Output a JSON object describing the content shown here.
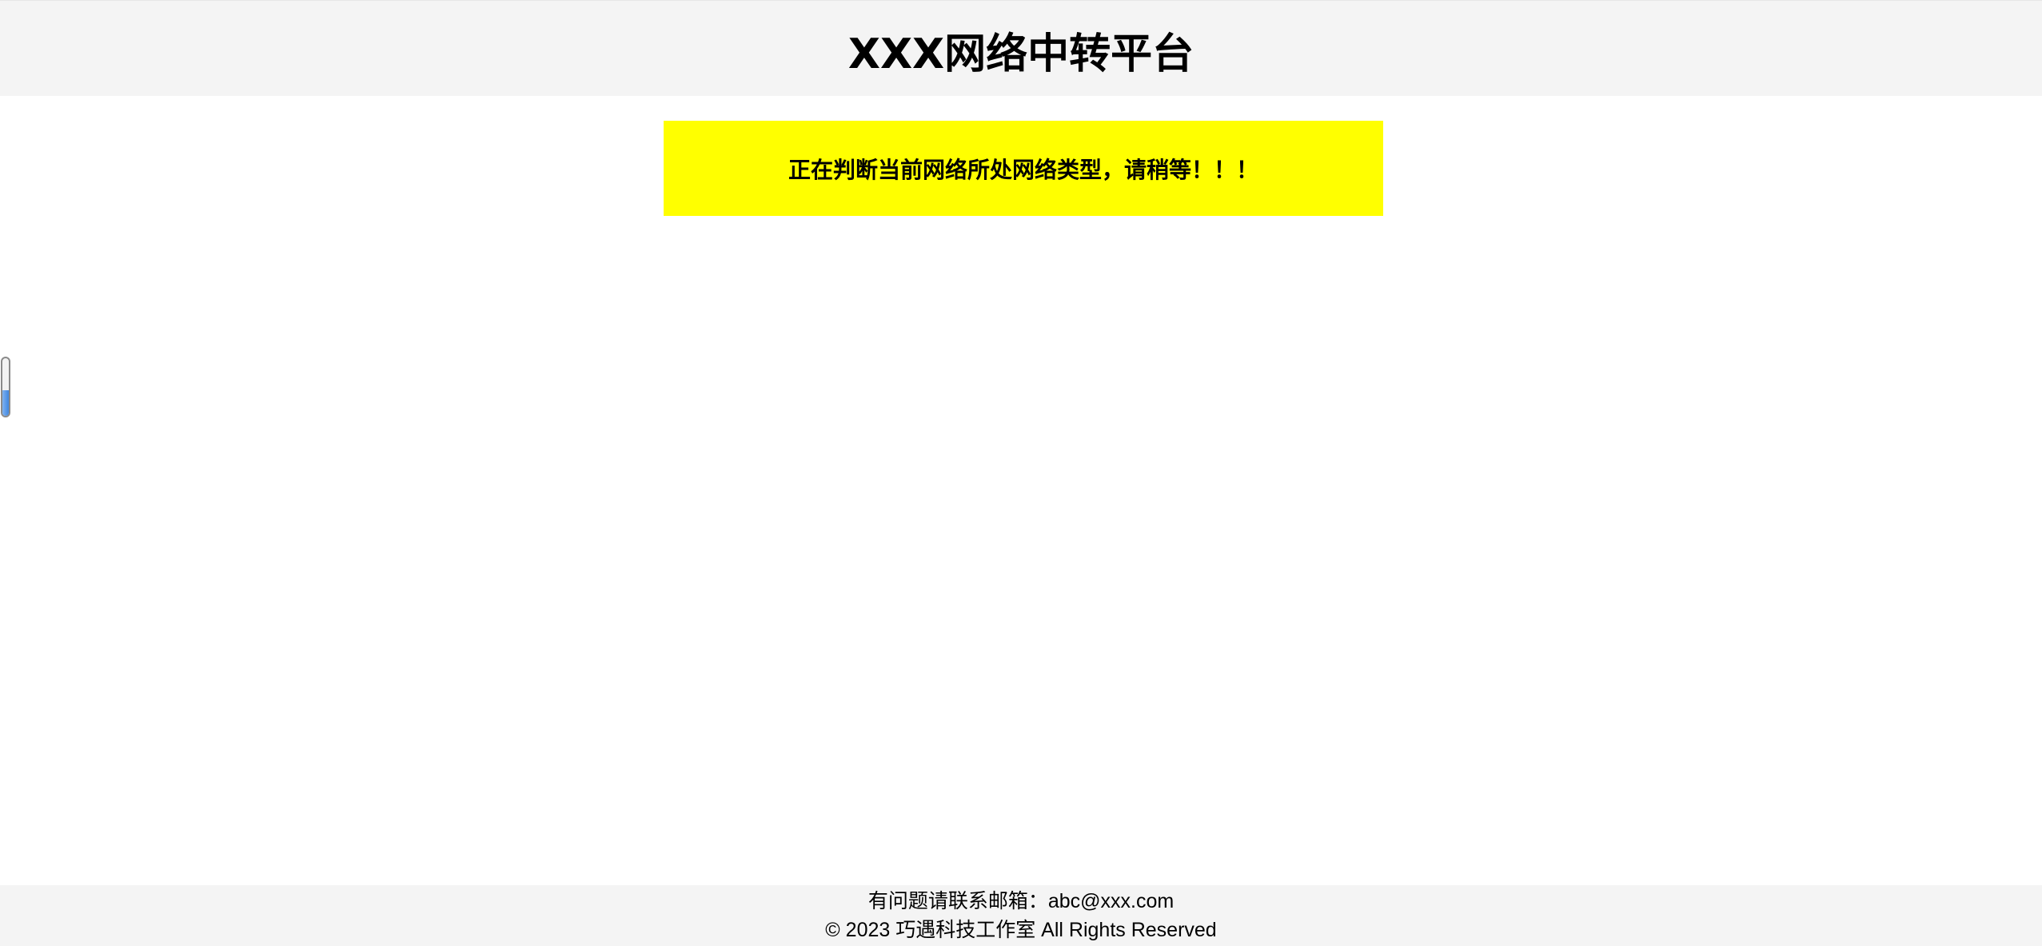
{
  "header": {
    "title": "XXX网络中转平台"
  },
  "status": {
    "message": "正在判断当前网络所处网络类型，请稍等！！！",
    "background_color": "#ffff00"
  },
  "progress": {
    "value_fraction": 0.45
  },
  "footer": {
    "contact_line": "有问题请联系邮箱：abc@xxx.com",
    "copyright_line": "© 2023 巧遇科技工作室 All Rights Reserved"
  }
}
